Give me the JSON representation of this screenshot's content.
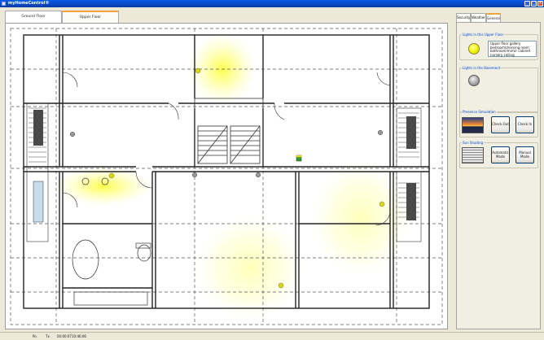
{
  "window": {
    "title": "myHomeControl®"
  },
  "floor_tabs": [
    {
      "label": "Ground Floor",
      "active": false
    },
    {
      "label": "Upper Floor",
      "active": true
    }
  ],
  "right_tabs": [
    {
      "label": "Security",
      "active": false
    },
    {
      "label": "Weather",
      "active": false
    },
    {
      "label": "General",
      "active": true
    }
  ],
  "lights_upper": {
    "title": "Lights in this Upper Floor",
    "items": [
      "Upper floor gallery",
      "bedroom/dressing room",
      "bathroom/mirror cabinet",
      "nursery ceiling"
    ]
  },
  "lights_basement": {
    "title": "Lights in the Basement"
  },
  "presence": {
    "title": "Presence Simulation",
    "check_out": "Check Out",
    "check_in": "Check In"
  },
  "sun_shading": {
    "title": "Sun Shading",
    "automatic": "Automatic Mode",
    "manual": "Manual Mode"
  },
  "status": {
    "col1": "Po",
    "col2": "Tx",
    "time1": "00:00:07",
    "time2": "10:46:06"
  },
  "colors": {
    "tab_highlight": "#f2a43c",
    "group_title": "#0046d5",
    "light_on": "#f4f000",
    "titlebar": "#0b46c4"
  }
}
